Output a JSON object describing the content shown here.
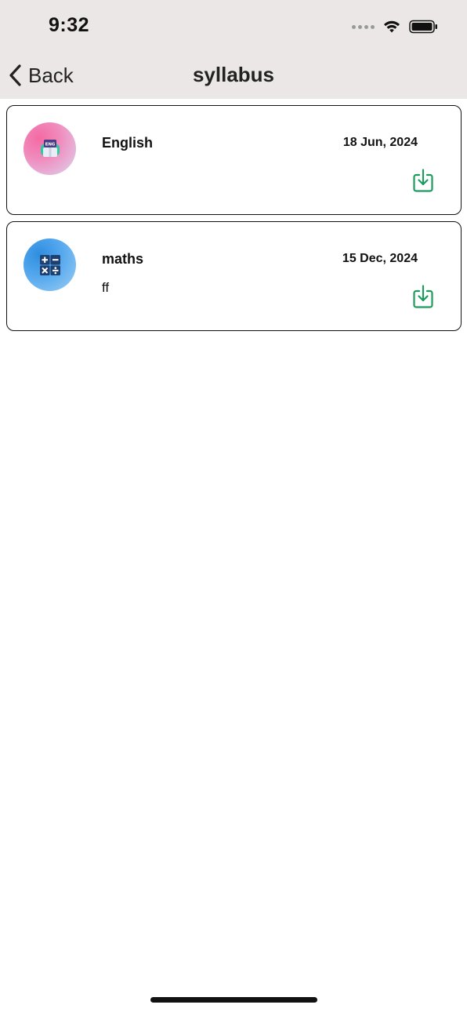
{
  "status_bar": {
    "time": "9:32",
    "icons": [
      "signal-dots-icon",
      "wifi-icon",
      "battery-icon"
    ]
  },
  "nav": {
    "back_label": "Back",
    "title": "syllabus"
  },
  "colors": {
    "header_bg": "#ebe7e6",
    "download_icon": "#1e9a5e",
    "card_border": "#111111"
  },
  "syllabus": [
    {
      "name": "English",
      "description": "",
      "date": "18 Jun, 2024",
      "icon": "english-book-icon",
      "icon_text": "ENG"
    },
    {
      "name": "maths",
      "description": "ff",
      "date": "15 Dec, 2024",
      "icon": "math-calculator-icon"
    }
  ]
}
